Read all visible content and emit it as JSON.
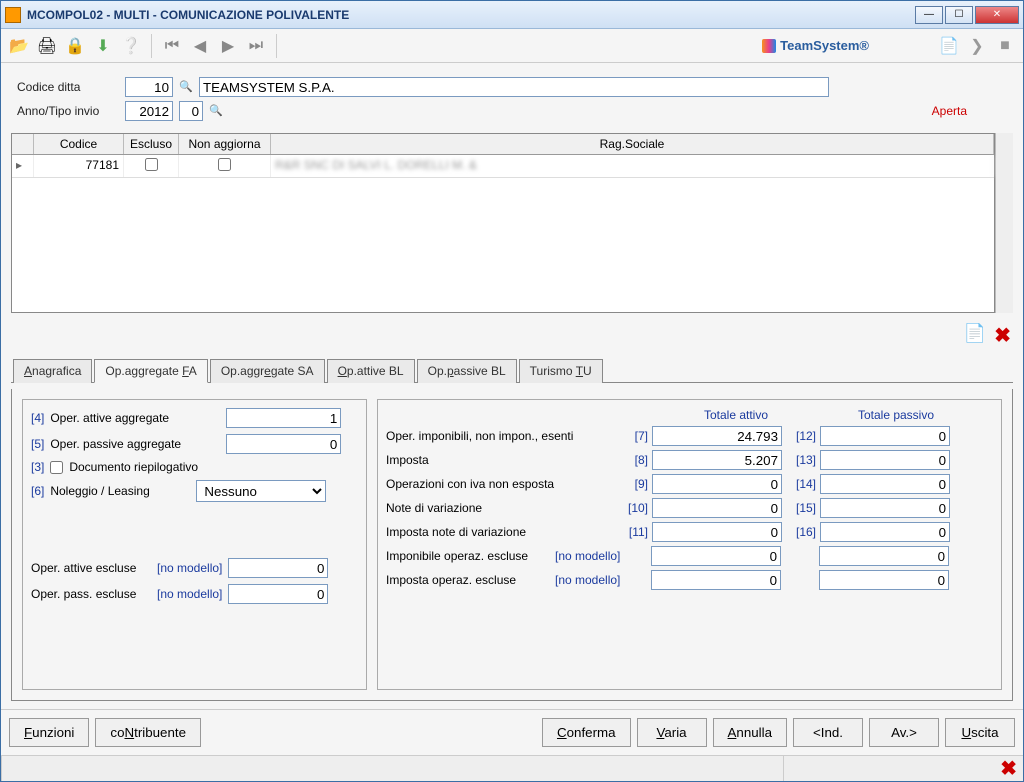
{
  "window": {
    "title": "MCOMPOL02  - MULTI -  COMUNICAZIONE POLIVALENTE",
    "brand": "TeamSystem®"
  },
  "winbtns": {
    "min": "—",
    "max": "☐",
    "close": "✕"
  },
  "header": {
    "codice_ditta_label": "Codice ditta",
    "codice_ditta": "10",
    "ragione_sociale": "TEAMSYSTEM S.P.A.",
    "anno_label": "Anno/Tipo invio",
    "anno": "2012",
    "tipo": "0",
    "status": "Aperta"
  },
  "grid": {
    "cols": {
      "codice": "Codice",
      "escluso": "Escluso",
      "non_agg": "Non aggiorna",
      "rag": "Rag.Sociale"
    },
    "rows": [
      {
        "codice": "77181",
        "escluso": false,
        "non_agg": false,
        "rag": "R&R SNC DI SALVI L. DORELLI M. &"
      }
    ]
  },
  "tabs": {
    "anagrafica": "Anagrafica",
    "op_fa": "Op.aggregate FA",
    "op_sa": "Op.aggregate SA",
    "op_att_bl": "Op.attive BL",
    "op_pass_bl": "Op.passive BL",
    "turismo": "Turismo TU"
  },
  "left": {
    "k4": "[4]",
    "l4": "Oper. attive aggregate",
    "v4": "1",
    "k5": "[5]",
    "l5": "Oper. passive aggregate",
    "v5": "0",
    "k3": "[3]",
    "l3": "Documento riepilogativo",
    "k6": "[6]",
    "l6": "Noleggio / Leasing",
    "v6": "Nessuno",
    "lae": "Oper. attive escluse",
    "nomod": "[no modello]",
    "vae": "0",
    "lpe": "Oper. pass. escluse",
    "vpe": "0"
  },
  "right": {
    "tot_att": "Totale attivo",
    "tot_pas": "Totale passivo",
    "l7": "Oper. imponibili, non impon., esenti",
    "k7": "[7]",
    "v7": "24.793",
    "k12": "[12]",
    "v12": "0",
    "l8": "Imposta",
    "k8": "[8]",
    "v8": "5.207",
    "k13": "[13]",
    "v13": "0",
    "l9": "Operazioni con iva non esposta",
    "k9": "[9]",
    "v9": "0",
    "k14": "[14]",
    "v14": "0",
    "l10": "Note di variazione",
    "k10": "[10]",
    "v10": "0",
    "k15": "[15]",
    "v15": "0",
    "l11": "Imposta note di variazione",
    "k11": "[11]",
    "v11": "0",
    "k16": "[16]",
    "v16": "0",
    "lie": "Imponibile operaz. escluse",
    "vie": "0",
    "vie2": "0",
    "lme": "Imposta operaz. escluse",
    "vme": "0",
    "vme2": "0"
  },
  "buttons": {
    "funzioni": "Funzioni",
    "contribuente": "coNtribuente",
    "conferma": "Conferma",
    "varia": "Varia",
    "annulla": "Annulla",
    "ind": "<Ind.",
    "av": "Av.>",
    "uscita": "Uscita"
  }
}
